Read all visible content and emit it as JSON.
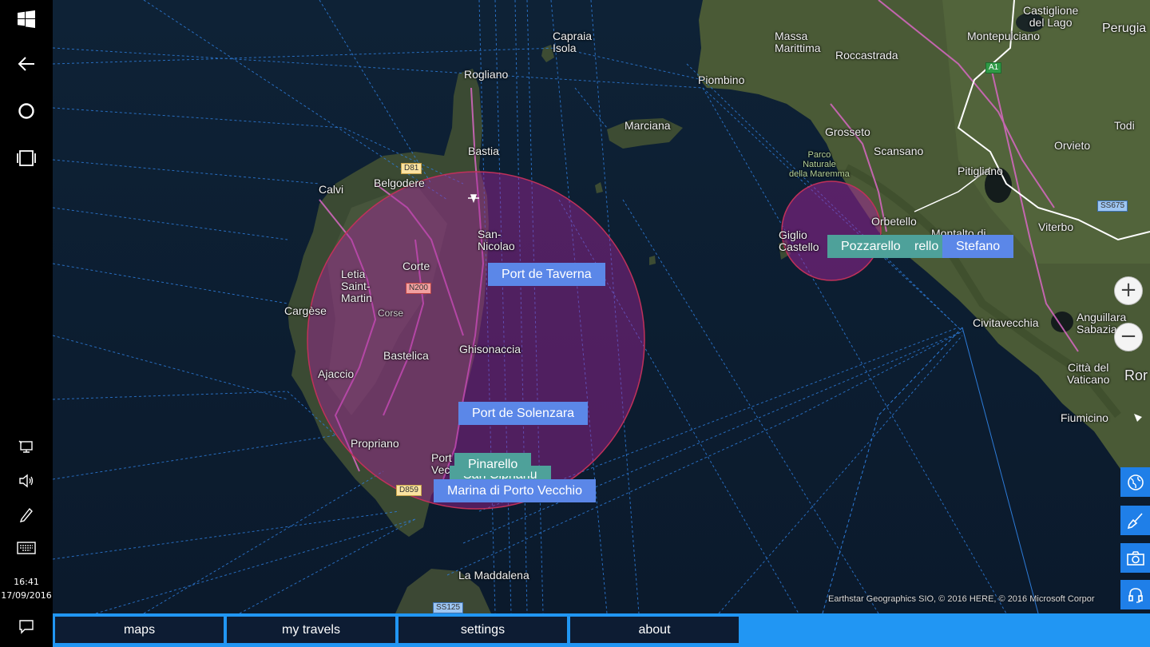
{
  "taskbar": {
    "icons": [
      "windows-start-icon",
      "back-arrow-icon",
      "cortana-icon",
      "task-view-icon"
    ],
    "tray_icons": [
      "network-icon",
      "volume-icon",
      "pen-icon",
      "keyboard-icon"
    ],
    "time": "16:41",
    "date": "17/09/2016",
    "action_center_icon": "action-center-icon"
  },
  "map": {
    "labels": {
      "capraia": "Capraia\nIsola",
      "rogliano": "Rogliano",
      "bastia": "Bastia",
      "calvi": "Calvi",
      "belgodere": "Belgodere",
      "san_nicolao": "San-\nNicolao",
      "corte": "Corte",
      "letia": "Letia\nSaint-\nMartin",
      "corse": "Corse",
      "cargese": "Cargèse",
      "bastelica": "Bastelica",
      "ghisonaccia": "Ghisonaccia",
      "ajaccio": "Ajaccio",
      "propriano": "Propriano",
      "porto_vecchio": "Port\nVec",
      "la_maddalena": "La Maddalena",
      "marciana": "Marciana",
      "piombino": "Piombino",
      "massa": "Massa\nMarittima",
      "roccastrada": "Roccastrada",
      "grosseto": "Grosseto",
      "scansano": "Scansano",
      "parco": "Parco\nNaturale\ndella Maremma",
      "orbetello": "Orbetello",
      "giglio": "Giglio\nCastello",
      "castiglione": "Castiglione\ndel Lago",
      "montepulciano": "Montepulciano",
      "perugia": "Perugia",
      "todi": "Todi",
      "orvieto": "Orvieto",
      "pitigliano": "Pitigliano",
      "viterbo": "Viterbo",
      "montalto": "Montalto di",
      "civitavecchia": "Civitavecchia",
      "anguillara": "Anguillara\nSabazia",
      "citta_vaticano": "Città del\nVaticano",
      "fiumicino": "Fiumicino",
      "roma": "Ror"
    },
    "road_shields": {
      "d81": "D81",
      "n200": "N200",
      "d859": "D859",
      "ss125": "SS125",
      "a1": "A1",
      "ss675": "SS675"
    },
    "pins": {
      "port_de_taverna": "Port de Taverna",
      "port_de_solenzara": "Port de Solenzara",
      "pinarello": "Pinarello",
      "san_ciprianu": "San Ciprianu",
      "marina_porto_vecchio": "Marina di Porto Vecchio",
      "pozzarello": "Pozzarello",
      "rello": "rello",
      "stefano": "Stefano"
    },
    "zoom_in_symbol": "+",
    "zoom_out_symbol": "−",
    "attribution": "Earthstar Geographics  SIO, © 2016 HERE, © 2016 Microsoft Corpor",
    "colors": {
      "circle_fill": "#a3239b",
      "pin_blue": "#5b87e8",
      "pin_teal": "#4ea19a",
      "route_lines": "#2d7bd8"
    }
  },
  "side_tools": [
    "globe-icon",
    "brush-icon",
    "camera-icon",
    "headset-icon"
  ],
  "appbar": {
    "buttons": [
      "maps",
      "my travels",
      "settings",
      "about"
    ],
    "accent_color": "#2196f3"
  }
}
